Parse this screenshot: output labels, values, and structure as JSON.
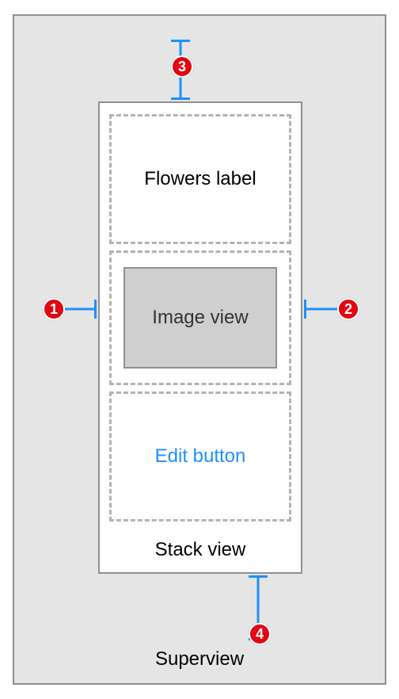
{
  "superview": {
    "label": "Superview"
  },
  "stackview": {
    "label": "Stack view",
    "cells": {
      "flowers": {
        "label": "Flowers label"
      },
      "image": {
        "label": "Image view"
      },
      "edit": {
        "label": "Edit button"
      }
    }
  },
  "constraints": {
    "leading": {
      "badge": "1"
    },
    "trailing": {
      "badge": "2"
    },
    "top": {
      "badge": "3"
    },
    "bottom": {
      "badge": "4"
    }
  }
}
